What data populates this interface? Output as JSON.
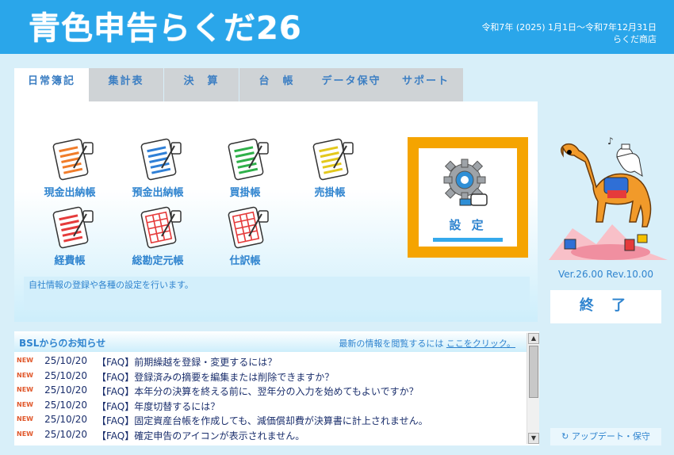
{
  "app": {
    "title": "青色申告らくだ26",
    "period": "令和7年 (2025) 1月1日～令和7年12月31日",
    "company": "らくだ商店"
  },
  "tabs": [
    {
      "label": "日常簿記",
      "active": true
    },
    {
      "label": "集計表",
      "active": false
    },
    {
      "label": "決　算",
      "active": false
    },
    {
      "label": "台　帳",
      "active": false
    },
    {
      "label": "データ保守",
      "active": false
    },
    {
      "label": "サポート",
      "active": false
    }
  ],
  "ledgers": [
    {
      "label": "現金出納帳",
      "icon": "orange-ledger-icon",
      "color": "#f07c2a"
    },
    {
      "label": "預金出納帳",
      "icon": "blue-ledger-icon",
      "color": "#2f7fd6"
    },
    {
      "label": "買掛帳",
      "icon": "green-ledger-icon",
      "color": "#2fb04a"
    },
    {
      "label": "売掛帳",
      "icon": "yellow-ledger-icon",
      "color": "#e3c81c"
    },
    {
      "label": "経費帳",
      "icon": "red-ledger-icon",
      "color": "#e53b3b"
    },
    {
      "label": "総勘定元帳",
      "icon": "red-ledger-icon",
      "color": "#e53b3b"
    },
    {
      "label": "仕訳帳",
      "icon": "red-ledger-icon",
      "color": "#e53b3b"
    }
  ],
  "settings": {
    "label": "設 定",
    "icon": "gear-icon"
  },
  "description": "自社情報の登録や各種の設定を行います。",
  "news": {
    "title": "BSLからのお知らせ",
    "more_prefix": "最新の情報を閲覧するには",
    "more_link": "ここをクリック。",
    "new_badge": "NEW",
    "items": [
      {
        "date": "25/10/20",
        "text": "【FAQ】前期繰越を登録・変更するには？"
      },
      {
        "date": "25/10/20",
        "text": "【FAQ】登録済みの摘要を編集または削除できますか？"
      },
      {
        "date": "25/10/20",
        "text": "【FAQ】本年分の決算を終える前に、翌年分の入力を始めてもよいですか？"
      },
      {
        "date": "25/10/20",
        "text": "【FAQ】年度切替するには？"
      },
      {
        "date": "25/10/20",
        "text": "【FAQ】固定資産台帳を作成しても、減価償却費が決算書に計上されません。"
      },
      {
        "date": "25/10/20",
        "text": "【FAQ】確定申告のアイコンが表示されません。"
      }
    ]
  },
  "version": "Ver.26.00 Rev.10.00",
  "exit_label": "終 了",
  "update_label": "↻ アップデート・保守",
  "colors": {
    "header": "#2aa6ea",
    "accent": "#2f84cf",
    "settings_frame": "#f5a400"
  }
}
